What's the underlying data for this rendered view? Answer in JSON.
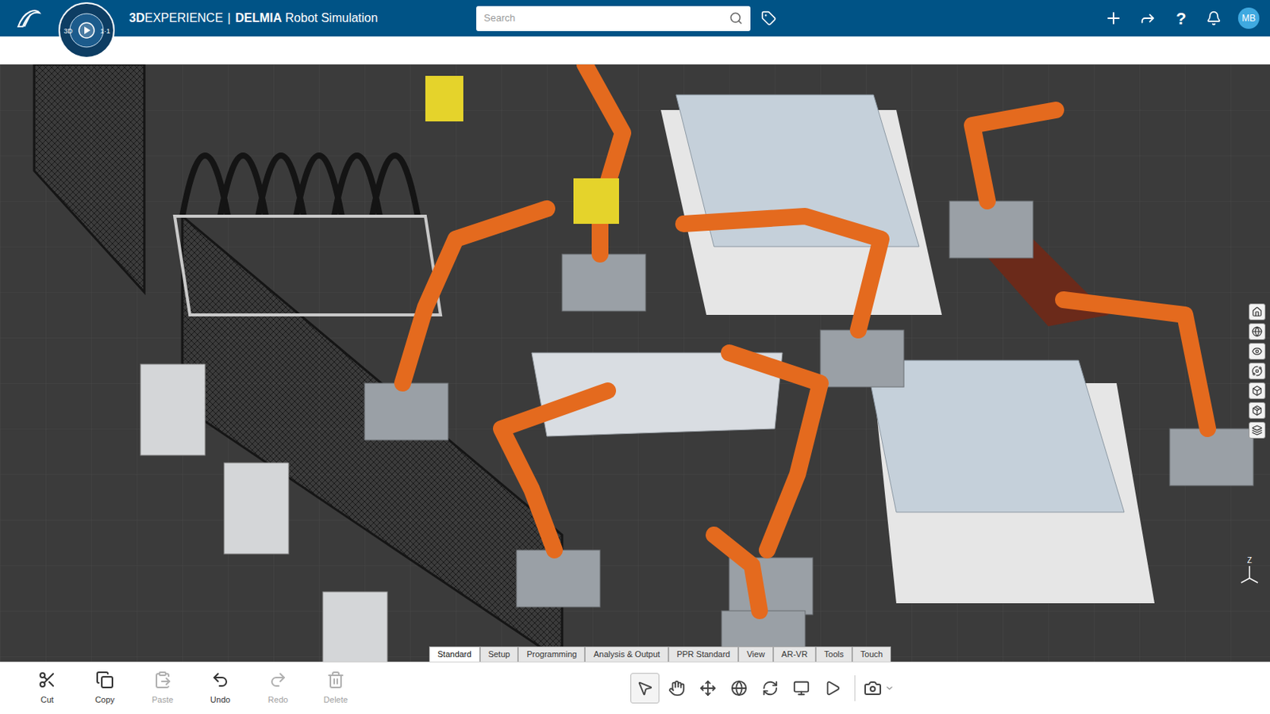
{
  "header": {
    "brand_bold": "3D",
    "brand_rest": "EXPERIENCE",
    "separator": "|",
    "app": "DELMIA",
    "app_suffix": "Robot Simulation",
    "search": {
      "placeholder": "Search"
    },
    "help": "?",
    "avatar": "MB"
  },
  "compass": {
    "left": "3D",
    "right": "1·1"
  },
  "tabs": [
    {
      "label": "Standard",
      "selected": true
    },
    {
      "label": "Setup",
      "selected": false
    },
    {
      "label": "Programming",
      "selected": false
    },
    {
      "label": "Analysis & Output",
      "selected": false
    },
    {
      "label": "PPR Standard",
      "selected": false
    },
    {
      "label": "View",
      "selected": false
    },
    {
      "label": "AR-VR",
      "selected": false
    },
    {
      "label": "Tools",
      "selected": false
    },
    {
      "label": "Touch",
      "selected": false
    }
  ],
  "actions": [
    {
      "label": "Cut",
      "kind": "cut",
      "disabled": false
    },
    {
      "label": "Copy",
      "kind": "copy",
      "disabled": false
    },
    {
      "label": "Paste",
      "kind": "paste",
      "disabled": true
    },
    {
      "label": "Undo",
      "kind": "undo",
      "disabled": false
    },
    {
      "label": "Redo",
      "kind": "redo",
      "disabled": true
    },
    {
      "label": "Delete",
      "kind": "delete",
      "disabled": true
    }
  ],
  "view_tools": [
    {
      "kind": "select",
      "selected": true
    },
    {
      "kind": "pan",
      "selected": false
    },
    {
      "kind": "move",
      "selected": false
    },
    {
      "kind": "globe",
      "selected": false
    },
    {
      "kind": "rotate",
      "selected": false
    },
    {
      "kind": "display",
      "selected": false
    },
    {
      "kind": "play",
      "selected": false
    }
  ],
  "axis": {
    "label": "Z"
  }
}
